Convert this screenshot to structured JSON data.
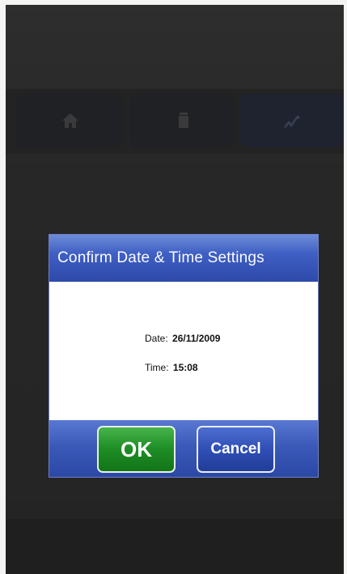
{
  "dialog": {
    "title": "Confirm Date & Time Settings",
    "date_label": "Date:",
    "date_value": "26/11/2009",
    "time_label": "Time:",
    "time_value": "15:08",
    "ok_label": "OK",
    "cancel_label": "Cancel"
  },
  "nav": {
    "tabs": [
      {
        "icon": "home-icon"
      },
      {
        "icon": "trash-icon"
      },
      {
        "icon": "signal-icon"
      }
    ]
  }
}
